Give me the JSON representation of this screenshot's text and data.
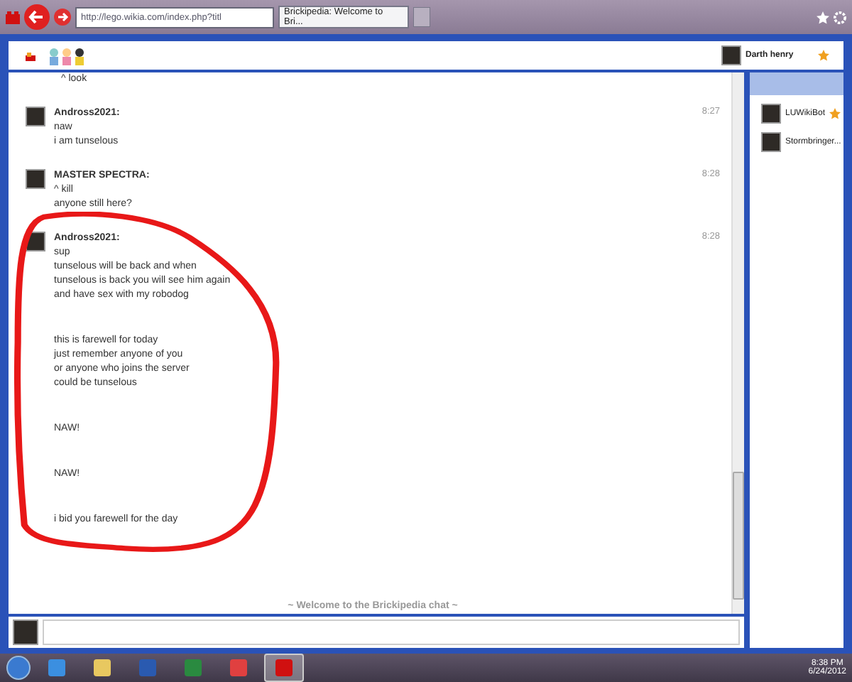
{
  "browser": {
    "address": "http://lego.wikia.com/index.php?titl",
    "tabs": [
      {
        "title": "Brickipedia: Welcome to Bri...",
        "selected": true
      }
    ]
  },
  "header": {
    "current_user": {
      "name": "Darth henry",
      "starred": true
    }
  },
  "chat": {
    "cut_line": "^ look",
    "messages": [
      {
        "author": "Andross2021:",
        "time": "8:27",
        "paragraphs": [
          [
            "naw",
            "i am tunselous"
          ]
        ],
        "circled": false
      },
      {
        "author": "MASTER SPECTRA:",
        "time": "8:28",
        "paragraphs": [
          [
            "^ kill",
            "anyone still here?"
          ]
        ],
        "circled": false
      },
      {
        "author": "Andross2021:",
        "time": "8:28",
        "paragraphs": [
          [
            "sup",
            "tunselous will be back and when",
            "tunselous is back you will see him again",
            "and have sex with my robodog"
          ],
          [
            "this is farewell for today",
            "just remember anyone of you",
            "or anyone who joins the server",
            "could be tunselous"
          ],
          [
            "NAW!"
          ],
          [
            "NAW!"
          ],
          [
            "i bid you farewell for the day"
          ]
        ],
        "circled": true
      }
    ],
    "welcome": "~ Welcome to the Brickipedia chat ~"
  },
  "users": [
    {
      "name": "LUWikiBot",
      "starred": true
    },
    {
      "name": "Stormbringer...",
      "starred": false
    }
  ],
  "taskbar": {
    "apps": [
      {
        "kind": "ie",
        "active": false
      },
      {
        "kind": "folder",
        "active": false
      },
      {
        "kind": "word",
        "active": false
      },
      {
        "kind": "excel",
        "active": false
      },
      {
        "kind": "picasa",
        "active": false
      },
      {
        "kind": "lego",
        "active": true
      }
    ],
    "time": "8:38 PM",
    "date": "6/24/2012"
  }
}
